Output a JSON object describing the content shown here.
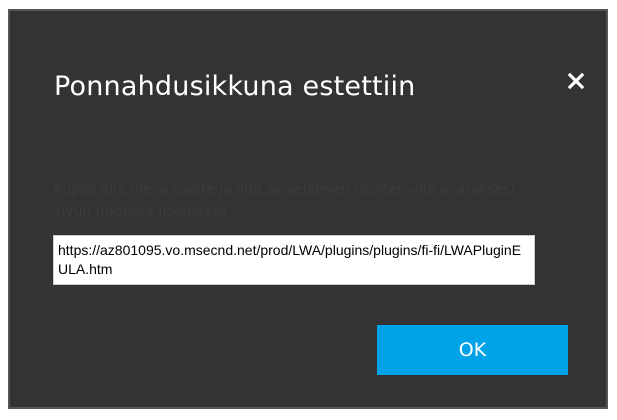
{
  "dialog": {
    "title": "Ponnahdusikkuna estettiin",
    "close_icon": "close-icon",
    "message": "Kopioi alla oleva osoite ja liitä se selaimen osoiteriville avataksesi sivun uudessa ikkunassa.",
    "url": "https://az801095.vo.msecnd.net/prod/LWA/plugins/plugins/fi-fi/LWAPluginEULA.htm",
    "ok_label": "OK"
  },
  "colors": {
    "dialog_background": "#333333",
    "dialog_border": "#555555",
    "accent_button": "#00a2e8",
    "title_text": "#ffffff"
  }
}
